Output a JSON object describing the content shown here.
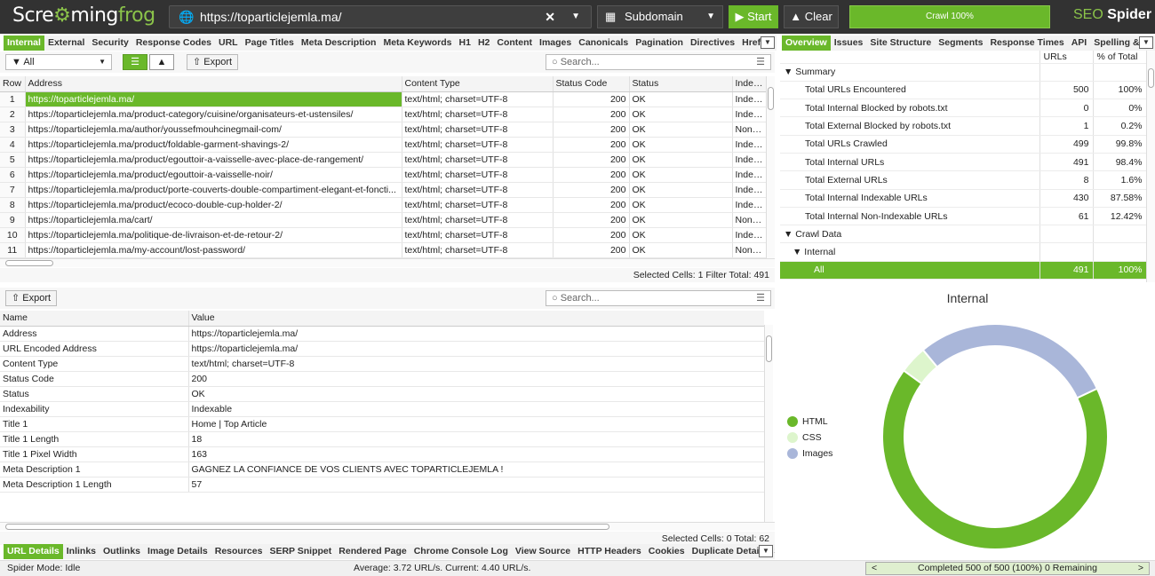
{
  "app": {
    "logo_part1": "Scre",
    "logo_part2": "ming",
    "logo_part3": "frog",
    "url": "https://toparticlejemla.ma/",
    "mode": "Subdomain",
    "start_label": "Start",
    "clear_label": "Clear",
    "crawl_progress_label": "Crawl 100%",
    "crawl_progress": 1.0,
    "brand_seo": "SEO",
    "brand_spider": "Spider",
    "accent_color": "#6ab82a"
  },
  "main_tabs": [
    "Internal",
    "External",
    "Security",
    "Response Codes",
    "URL",
    "Page Titles",
    "Meta Description",
    "Meta Keywords",
    "H1",
    "H2",
    "Content",
    "Images",
    "Canonicals",
    "Pagination",
    "Directives",
    "Hrefl"
  ],
  "main_toolbar": {
    "filter": "All",
    "export": "Export",
    "search_placeholder": "Search..."
  },
  "main_table": {
    "columns": [
      "Row",
      "Address",
      "Content Type",
      "Status Code",
      "Status",
      "Indexat"
    ],
    "rows": [
      [
        "1",
        "https://toparticlejemla.ma/",
        "text/html; charset=UTF-8",
        "200",
        "OK",
        "Indexat"
      ],
      [
        "2",
        "https://toparticlejemla.ma/product-category/cuisine/organisateurs-et-ustensiles/",
        "text/html; charset=UTF-8",
        "200",
        "OK",
        "Indexat"
      ],
      [
        "3",
        "https://toparticlejemla.ma/author/youssefmouhcinegmail-com/",
        "text/html; charset=UTF-8",
        "200",
        "OK",
        "Non-Inc"
      ],
      [
        "4",
        "https://toparticlejemla.ma/product/foldable-garment-shavings-2/",
        "text/html; charset=UTF-8",
        "200",
        "OK",
        "Indexat"
      ],
      [
        "5",
        "https://toparticlejemla.ma/product/egouttoir-a-vaisselle-avec-place-de-rangement/",
        "text/html; charset=UTF-8",
        "200",
        "OK",
        "Indexat"
      ],
      [
        "6",
        "https://toparticlejemla.ma/product/egouttoir-a-vaisselle-noir/",
        "text/html; charset=UTF-8",
        "200",
        "OK",
        "Indexat"
      ],
      [
        "7",
        "https://toparticlejemla.ma/product/porte-couverts-double-compartiment-elegant-et-foncti...",
        "text/html; charset=UTF-8",
        "200",
        "OK",
        "Indexat"
      ],
      [
        "8",
        "https://toparticlejemla.ma/product/ecoco-double-cup-holder-2/",
        "text/html; charset=UTF-8",
        "200",
        "OK",
        "Indexat"
      ],
      [
        "9",
        "https://toparticlejemla.ma/cart/",
        "text/html; charset=UTF-8",
        "200",
        "OK",
        "Non-Inc"
      ],
      [
        "10",
        "https://toparticlejemla.ma/politique-de-livraison-et-de-retour-2/",
        "text/html; charset=UTF-8",
        "200",
        "OK",
        "Indexat"
      ],
      [
        "11",
        "https://toparticlejemla.ma/my-account/lost-password/",
        "text/html; charset=UTF-8",
        "200",
        "OK",
        "Non-Inc"
      ]
    ],
    "status_text": "Selected Cells: 1  Filter Total: 491"
  },
  "detail_toolbar": {
    "export": "Export",
    "search_placeholder": "Search..."
  },
  "detail_table": {
    "columns": [
      "Name",
      "Value"
    ],
    "rows": [
      [
        "Address",
        "https://toparticlejemla.ma/"
      ],
      [
        "URL Encoded Address",
        "https://toparticlejemla.ma/"
      ],
      [
        "Content Type",
        "text/html; charset=UTF-8"
      ],
      [
        "Status Code",
        "200"
      ],
      [
        "Status",
        "OK"
      ],
      [
        "Indexability",
        "Indexable"
      ],
      [
        "Title 1",
        "Home | Top Article"
      ],
      [
        "Title 1 Length",
        "18"
      ],
      [
        "Title 1 Pixel Width",
        "163"
      ],
      [
        "Meta Description 1",
        "GAGNEZ LA CONFIANCE DE VOS CLIENTS AVEC TOPARTICLEJEMLA !"
      ],
      [
        "Meta Description 1 Length",
        "57"
      ]
    ],
    "status_text": "Selected Cells: 0  Total: 62"
  },
  "bottom_tabs": [
    "URL Details",
    "Inlinks",
    "Outlinks",
    "Image Details",
    "Resources",
    "SERP Snippet",
    "Rendered Page",
    "Chrome Console Log",
    "View Source",
    "HTTP Headers",
    "Cookies",
    "Duplicate Details",
    "S"
  ],
  "right_tabs": [
    "Overview",
    "Issues",
    "Site Structure",
    "Segments",
    "Response Times",
    "API",
    "Spelling & ("
  ],
  "overview": {
    "col_urls": "URLs",
    "col_pct": "% of Total",
    "summary_label": "Summary",
    "rows": [
      [
        "Total URLs Encountered",
        "500",
        "100%"
      ],
      [
        "Total Internal Blocked by robots.txt",
        "0",
        "0%"
      ],
      [
        "Total External Blocked by robots.txt",
        "1",
        "0.2%"
      ],
      [
        "Total URLs Crawled",
        "499",
        "99.8%"
      ],
      [
        "Total Internal URLs",
        "491",
        "98.4%"
      ],
      [
        "Total External URLs",
        "8",
        "1.6%"
      ],
      [
        "Total Internal Indexable URLs",
        "430",
        "87.58%"
      ],
      [
        "Total Internal Non-Indexable URLs",
        "61",
        "12.42%"
      ]
    ],
    "crawl_data_label": "Crawl Data",
    "internal_label": "Internal",
    "all_row": [
      "All",
      "491",
      "100%"
    ]
  },
  "chart_data": {
    "type": "pie",
    "title": "Internal",
    "labels": [
      "HTML",
      "CSS",
      "Images"
    ],
    "values": [
      67,
      4,
      29
    ],
    "colors": [
      "#6ab82a",
      "#ddf5cc",
      "#a9b6d9"
    ]
  },
  "status_bar": {
    "mode": "Spider Mode: Idle",
    "rate": "Average: 3.72 URL/s. Current: 4.40 URL/s.",
    "completed": "Completed 500 of 500 (100%) 0 Remaining"
  }
}
